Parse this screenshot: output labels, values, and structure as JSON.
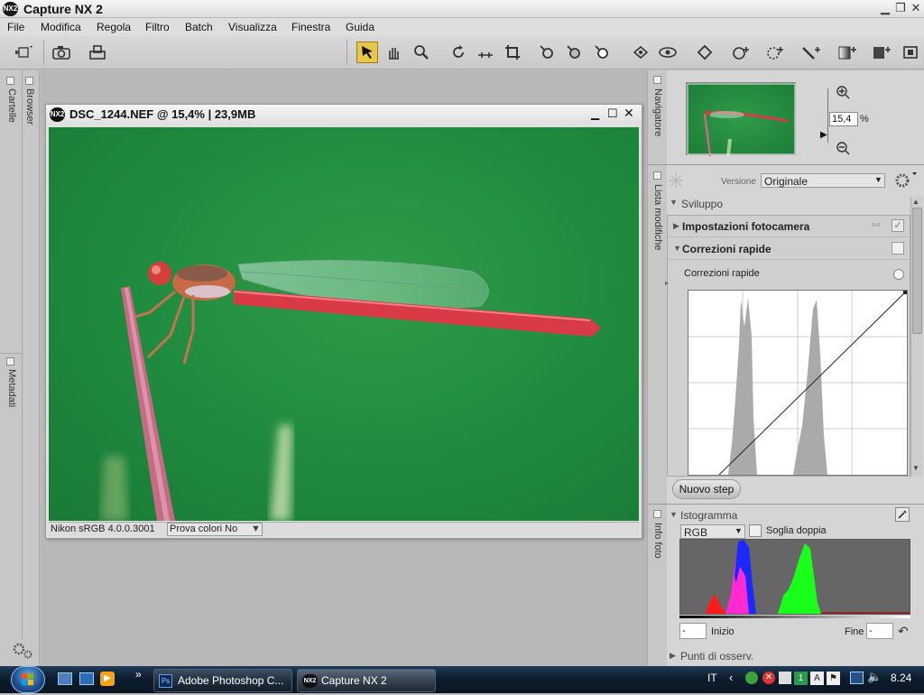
{
  "app": {
    "title": "Capture NX 2",
    "logo": "NX2"
  },
  "menu": [
    "File",
    "Modifica",
    "Regola",
    "Filtro",
    "Batch",
    "Visualizza",
    "Finestra",
    "Guida"
  ],
  "left_tabs": {
    "cartelle": "Cartelle",
    "browser": "Browser",
    "metadati": "Metadati"
  },
  "image_window": {
    "title": "DSC_1244.NEF @ 15,4% | 23,9MB",
    "profile": "Nikon sRGB 4.0.0.3001",
    "proof": "Prova colori No"
  },
  "right_tabs": {
    "navigatore": "Navigatore",
    "lista": "Lista modifiche",
    "info": "Info foto"
  },
  "navigator": {
    "zoom": "15,4",
    "unit": "%"
  },
  "edit_list": {
    "version_label": "Versione",
    "version_value": "Originale",
    "section": "Sviluppo",
    "camera": "Impostazioni fotocamera",
    "quick": "Correzioni rapide",
    "quick_sub": "Correzioni rapide",
    "new_step": "Nuovo step"
  },
  "histogram": {
    "title": "Istogramma",
    "channel": "RGB",
    "dual": "Soglia doppia",
    "start_label": "Inizio",
    "end_label": "Fine",
    "start_value": "-",
    "end_value": "-",
    "points": "Punti di osserv."
  },
  "taskbar": {
    "items": [
      "Adobe Photoshop C...",
      "Capture NX 2"
    ],
    "lang": "IT",
    "clock": "8.24"
  },
  "colors": {
    "accent": "#f0c040",
    "photo_bg": "#238f40",
    "damselfly": "#d8404a"
  }
}
